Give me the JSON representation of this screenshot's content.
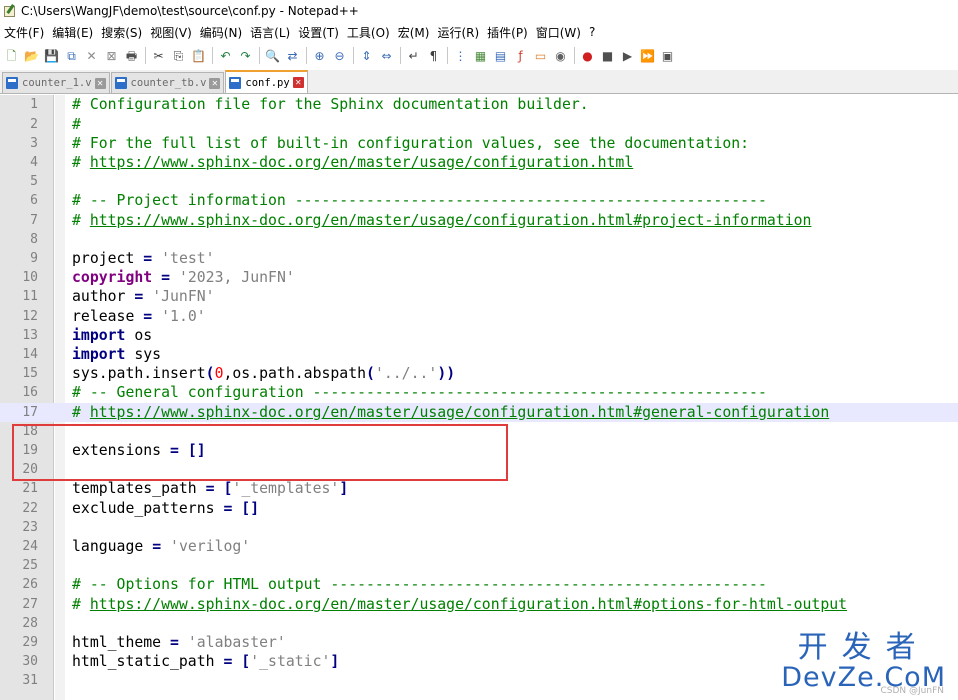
{
  "window": {
    "title": "C:\\Users\\WangJF\\demo\\test\\source\\conf.py - Notepad++"
  },
  "menu": [
    "文件(F)",
    "编辑(E)",
    "搜索(S)",
    "视图(V)",
    "编码(N)",
    "语言(L)",
    "设置(T)",
    "工具(O)",
    "宏(M)",
    "运行(R)",
    "插件(P)",
    "窗口(W)",
    "?"
  ],
  "toolbar": {
    "icons": [
      "new-file-icon",
      "open-file-icon",
      "save-icon",
      "save-all-icon",
      "close-icon",
      "close-all-icon",
      "print-icon",
      "cut-icon",
      "copy-icon",
      "paste-icon",
      "undo-icon",
      "redo-icon",
      "find-icon",
      "replace-icon",
      "zoom-in-icon",
      "zoom-out-icon",
      "sync-vertical-icon",
      "sync-horizontal-icon",
      "word-wrap-icon",
      "show-all-chars-icon",
      "indent-guide-icon",
      "udl-icon",
      "doc-map-icon",
      "function-list-icon",
      "folder-workspace-icon",
      "monitoring-icon",
      "record-macro-icon",
      "stop-macro-icon",
      "play-macro-icon",
      "run-macro-multiple-icon",
      "save-macro-icon"
    ],
    "glyphs": [
      "🗋",
      "📂",
      "💾",
      "⧉",
      "✕",
      "⊠",
      "🖶",
      "✂",
      "⎘",
      "📋",
      "↶",
      "↷",
      "🔍",
      "⇄",
      "⊕",
      "⊖",
      "⇕",
      "⇔",
      "↵",
      "¶",
      "⋮",
      "▦",
      "▤",
      "ƒ",
      "▭",
      "◉",
      "●",
      "■",
      "▶",
      "⏩",
      "▣"
    ]
  },
  "tabs": [
    {
      "label": "counter_1.v",
      "active": false
    },
    {
      "label": "counter_tb.v",
      "active": false
    },
    {
      "label": "conf.py",
      "active": true
    }
  ],
  "editor": {
    "current_line": 17,
    "lines": [
      {
        "n": "1",
        "tokens": [
          [
            "c",
            "# Configuration file for the Sphinx documentation builder."
          ]
        ]
      },
      {
        "n": "2",
        "tokens": [
          [
            "c",
            "#"
          ]
        ]
      },
      {
        "n": "3",
        "tokens": [
          [
            "c",
            "# For the full list of built-in configuration values, see the documentation:"
          ]
        ]
      },
      {
        "n": "4",
        "tokens": [
          [
            "c",
            "# "
          ],
          [
            "u",
            "https://www.sphinx-doc.org/en/master/usage/configuration.html"
          ]
        ]
      },
      {
        "n": "5",
        "tokens": []
      },
      {
        "n": "6",
        "tokens": [
          [
            "c",
            "# -- Project information -----------------------------------------------------"
          ]
        ]
      },
      {
        "n": "7",
        "tokens": [
          [
            "c",
            "# "
          ],
          [
            "u",
            "https://www.sphinx-doc.org/en/master/usage/configuration.html#project-information"
          ]
        ]
      },
      {
        "n": "8",
        "tokens": []
      },
      {
        "n": "9",
        "tokens": [
          [
            "p",
            "project "
          ],
          [
            "o",
            "="
          ],
          [
            "p",
            " "
          ],
          [
            "s",
            "'test'"
          ]
        ]
      },
      {
        "n": "10",
        "tokens": [
          [
            "k2",
            "copyright"
          ],
          [
            "p",
            " "
          ],
          [
            "o",
            "="
          ],
          [
            "p",
            " "
          ],
          [
            "s",
            "'2023, JunFN'"
          ]
        ]
      },
      {
        "n": "11",
        "tokens": [
          [
            "p",
            "author "
          ],
          [
            "o",
            "="
          ],
          [
            "p",
            " "
          ],
          [
            "s",
            "'JunFN'"
          ]
        ]
      },
      {
        "n": "12",
        "tokens": [
          [
            "p",
            "release "
          ],
          [
            "o",
            "="
          ],
          [
            "p",
            " "
          ],
          [
            "s",
            "'1.0'"
          ]
        ]
      },
      {
        "n": "13",
        "tokens": [
          [
            "k",
            "import"
          ],
          [
            "p",
            " os"
          ]
        ]
      },
      {
        "n": "14",
        "tokens": [
          [
            "k",
            "import"
          ],
          [
            "p",
            " sys"
          ]
        ]
      },
      {
        "n": "15",
        "tokens": [
          [
            "p",
            "sys.path.insert"
          ],
          [
            "o",
            "("
          ],
          [
            "n",
            "0"
          ],
          [
            "p",
            ",os.path.abspath"
          ],
          [
            "o",
            "("
          ],
          [
            "s",
            "'../..'"
          ],
          [
            "o",
            "))"
          ]
        ]
      },
      {
        "n": "16",
        "tokens": [
          [
            "c",
            "# -- General configuration ---------------------------------------------------"
          ]
        ]
      },
      {
        "n": "17",
        "tokens": [
          [
            "c",
            "# "
          ],
          [
            "u",
            "https://www.sphinx-doc.org/en/master/usage/configuration.html#general-configuration"
          ]
        ]
      },
      {
        "n": "18",
        "tokens": []
      },
      {
        "n": "19",
        "tokens": [
          [
            "p",
            "extensions "
          ],
          [
            "o",
            "="
          ],
          [
            "p",
            " "
          ],
          [
            "o",
            "[]"
          ]
        ]
      },
      {
        "n": "20",
        "tokens": []
      },
      {
        "n": "21",
        "tokens": [
          [
            "p",
            "templates_path "
          ],
          [
            "o",
            "="
          ],
          [
            "p",
            " "
          ],
          [
            "o",
            "["
          ],
          [
            "s",
            "'_templates'"
          ],
          [
            "o",
            "]"
          ]
        ]
      },
      {
        "n": "22",
        "tokens": [
          [
            "p",
            "exclude_patterns "
          ],
          [
            "o",
            "="
          ],
          [
            "p",
            " "
          ],
          [
            "o",
            "[]"
          ]
        ]
      },
      {
        "n": "23",
        "tokens": []
      },
      {
        "n": "24",
        "tokens": [
          [
            "p",
            "language "
          ],
          [
            "o",
            "="
          ],
          [
            "p",
            " "
          ],
          [
            "s",
            "'verilog'"
          ]
        ]
      },
      {
        "n": "25",
        "tokens": []
      },
      {
        "n": "26",
        "tokens": [
          [
            "c",
            "# -- Options for HTML output -------------------------------------------------"
          ]
        ]
      },
      {
        "n": "27",
        "tokens": [
          [
            "c",
            "# "
          ],
          [
            "u",
            "https://www.sphinx-doc.org/en/master/usage/configuration.html#options-for-html-output"
          ]
        ]
      },
      {
        "n": "28",
        "tokens": []
      },
      {
        "n": "29",
        "tokens": [
          [
            "p",
            "html_theme "
          ],
          [
            "o",
            "="
          ],
          [
            "p",
            " "
          ],
          [
            "s",
            "'alabaster'"
          ]
        ]
      },
      {
        "n": "30",
        "tokens": [
          [
            "p",
            "html_static_path "
          ],
          [
            "o",
            "="
          ],
          [
            "p",
            " "
          ],
          [
            "o",
            "["
          ],
          [
            "s",
            "'_static'"
          ],
          [
            "o",
            "]"
          ]
        ]
      },
      {
        "n": "31",
        "tokens": []
      }
    ]
  },
  "annotation": {
    "color": "#e03c3c"
  },
  "watermark": {
    "cn": "开发者",
    "en": "DevZe.CoM",
    "small": "CSDN @JunFN"
  }
}
